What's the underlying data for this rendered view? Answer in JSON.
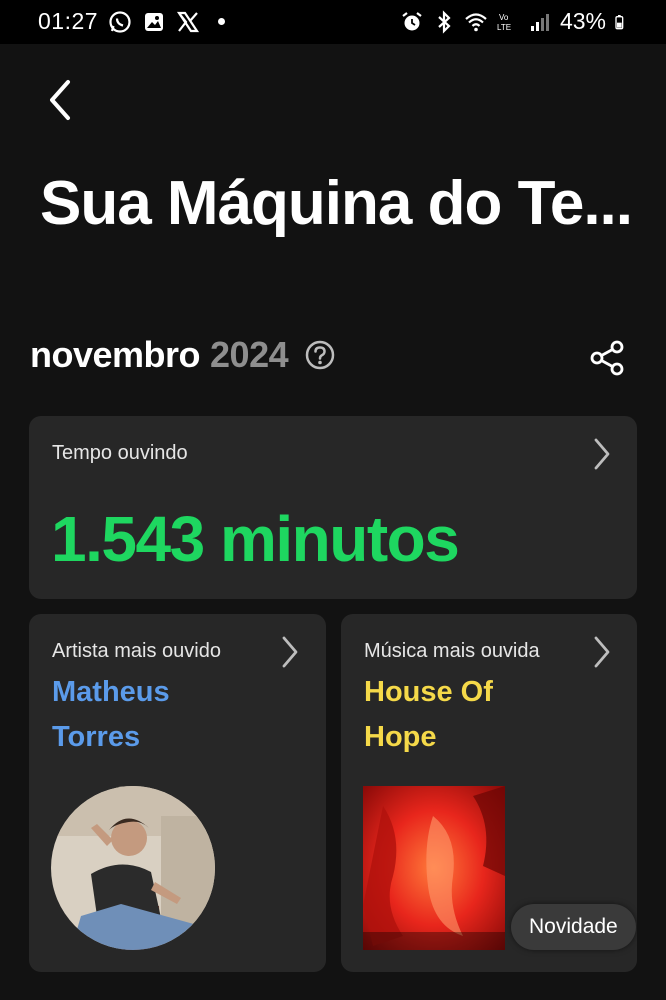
{
  "status_bar": {
    "time": "01:27",
    "battery": "43%",
    "left_icons": [
      "whatsapp-icon",
      "gallery-icon",
      "x-icon",
      "notification-dot"
    ],
    "right_icons": [
      "alarm-icon",
      "bluetooth-icon",
      "wifi-icon",
      "volte-icon",
      "signal-icon",
      "battery-icon"
    ]
  },
  "header": {
    "title": "Sua Máquina do Te..."
  },
  "period": {
    "month": "novembro",
    "year": "2024"
  },
  "listening_time": {
    "label": "Tempo ouvindo",
    "value": "1.543 minutos"
  },
  "top_artist": {
    "label": "Artista mais ouvido",
    "name_line1": "Matheus",
    "name_line2": "Torres"
  },
  "top_track": {
    "label": "Música mais ouvida",
    "name_line1": "House Of",
    "name_line2": "Hope",
    "badge": "Novidade"
  },
  "colors": {
    "background": "#121212",
    "card": "#272727",
    "accent_green": "#1ed760",
    "artist_blue": "#5b9bea",
    "track_yellow": "#f5d949",
    "year_gray": "#8e8e8e"
  }
}
